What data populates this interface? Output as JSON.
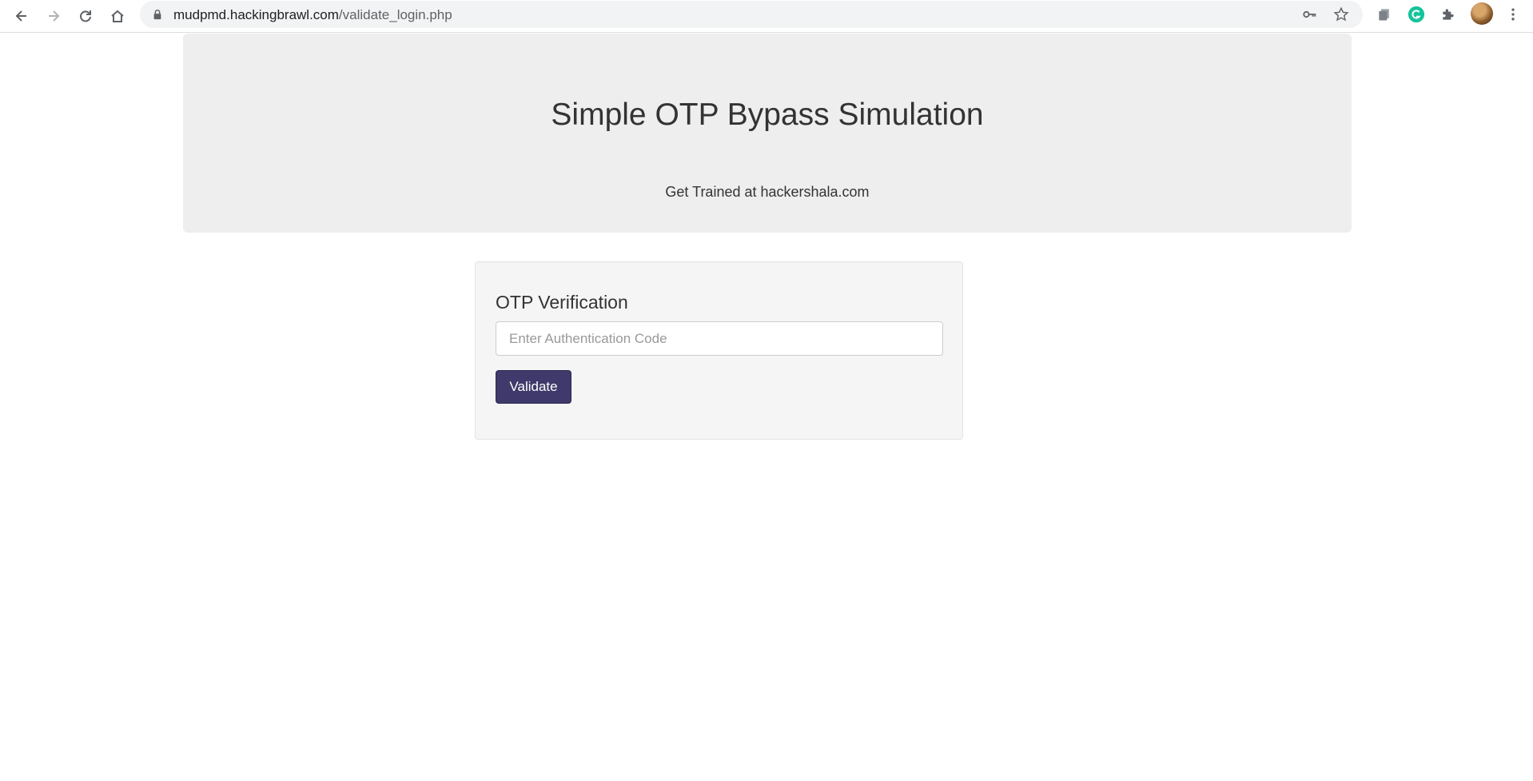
{
  "browser": {
    "url_host": "mudpmd.hackingbrawl.com",
    "url_path": "/validate_login.php",
    "icons": [
      "back-icon",
      "forward-icon",
      "reload-icon",
      "home-icon",
      "lock-icon",
      "key-icon",
      "star-icon",
      "extension-stack-icon",
      "grammarly-icon",
      "puzzle-icon",
      "avatar",
      "menu-icon"
    ],
    "grammarly_color": "#15c39a"
  },
  "header": {
    "title": "Simple OTP Bypass Simulation",
    "subtitle": "Get Trained at hackershala.com"
  },
  "form": {
    "heading": "OTP Verification",
    "input_placeholder": "Enter Authentication Code",
    "input_value": "",
    "button_label": "Validate",
    "button_color": "#3f3a6b"
  }
}
